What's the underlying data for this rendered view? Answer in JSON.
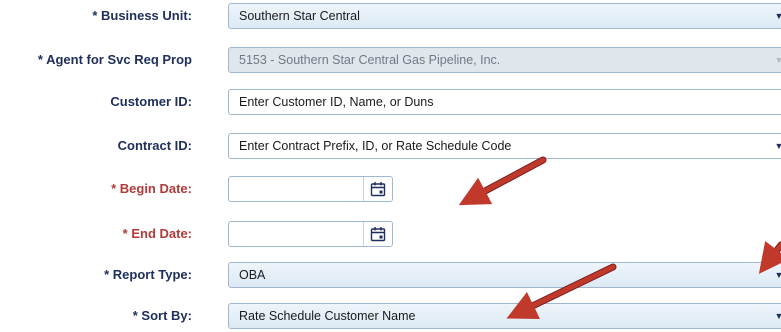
{
  "form": {
    "business_unit": {
      "label": "* Business Unit:",
      "value": "Southern Star Central"
    },
    "agent": {
      "label": "* Agent for Svc Req Prop",
      "value": "5153 - Southern Star Central Gas Pipeline, Inc."
    },
    "customer_id": {
      "label": "Customer ID:",
      "placeholder": "Enter Customer ID, Name, or Duns"
    },
    "contract_id": {
      "label": "Contract ID:",
      "placeholder": "Enter Contract Prefix, ID, or Rate Schedule Code"
    },
    "begin_date": {
      "label": "* Begin Date:",
      "value": ""
    },
    "end_date": {
      "label": "* End Date:",
      "value": ""
    },
    "report_type": {
      "label": "* Report Type:",
      "value": "OBA"
    },
    "sort_by": {
      "label": "* Sort By:",
      "value": "Rate Schedule Customer Name"
    }
  },
  "icons": {
    "dropdown": "chevron-down-icon",
    "calendar": "calendar-icon",
    "annotation": "arrow-annotation"
  },
  "colors": {
    "label": "#1f2f5c",
    "label_required_date": "#b03a3a",
    "field_border": "#9fb8cf",
    "annotation_arrow": "#c0392b"
  }
}
